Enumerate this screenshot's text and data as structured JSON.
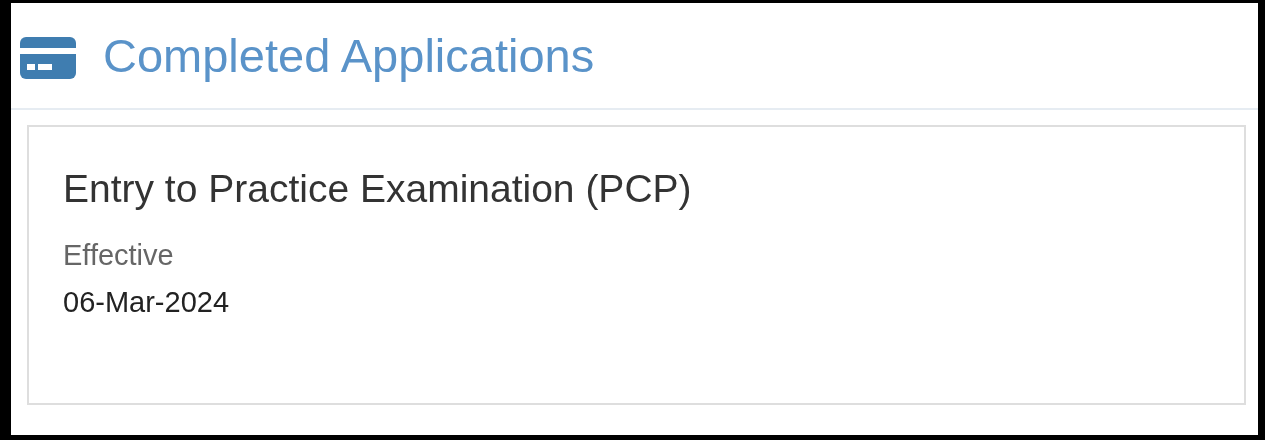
{
  "header": {
    "title": "Completed Applications"
  },
  "applications": [
    {
      "name": "Entry to Practice Examination (PCP)",
      "field_label": "Effective",
      "field_value": "06-Mar-2024"
    }
  ]
}
